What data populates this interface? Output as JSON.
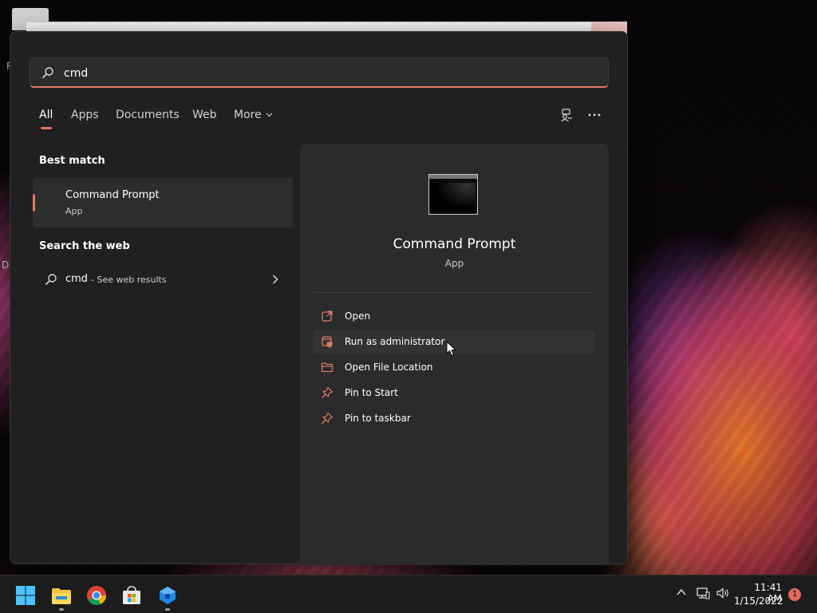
{
  "search": {
    "query": "cmd"
  },
  "tabs": [
    {
      "label": "All",
      "active": true
    },
    {
      "label": "Apps"
    },
    {
      "label": "Documents"
    },
    {
      "label": "Web"
    },
    {
      "label": "More"
    }
  ],
  "sections": {
    "best_match": "Best match",
    "search_web": "Search the web"
  },
  "best_match": {
    "name": "Command Prompt",
    "type": "App"
  },
  "web_result": {
    "term": "cmd",
    "suffix": "- See web results"
  },
  "detail": {
    "name": "Command Prompt",
    "type": "App",
    "actions": [
      {
        "label": "Open",
        "icon": "open-external-icon"
      },
      {
        "label": "Run as administrator",
        "icon": "shield-admin-icon"
      },
      {
        "label": "Open File Location",
        "icon": "folder-icon"
      },
      {
        "label": "Pin to Start",
        "icon": "pin-icon"
      },
      {
        "label": "Pin to taskbar",
        "icon": "pin-icon"
      }
    ]
  },
  "taskbar": {
    "time": "11:41 AM",
    "date": "1/15/2022",
    "notification_count": "1"
  },
  "colors": {
    "accent": "#e0786a",
    "panel": "#202020",
    "detail_panel": "#2b2b2b",
    "taskbar": "#1c1c1c"
  }
}
